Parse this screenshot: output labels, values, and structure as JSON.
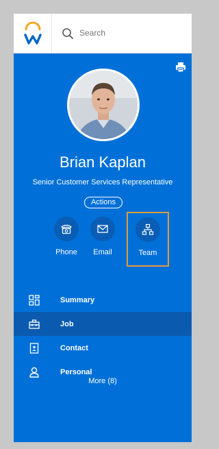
{
  "search": {
    "placeholder": "Search"
  },
  "profile": {
    "name": "Brian Kaplan",
    "job_title": "Senior Customer Services Representative",
    "actions_label": "Actions"
  },
  "quick_actions": [
    {
      "label": "Phone",
      "icon": "phone-icon"
    },
    {
      "label": "Email",
      "icon": "email-icon"
    },
    {
      "label": "Team",
      "icon": "team-icon"
    }
  ],
  "nav": {
    "items": [
      {
        "label": "Summary",
        "icon": "summary-grid-icon"
      },
      {
        "label": "Job",
        "icon": "job-briefcase-icon"
      },
      {
        "label": "Contact",
        "icon": "contact-book-icon"
      },
      {
        "label": "Personal",
        "icon": "person-icon"
      }
    ],
    "active": "Job",
    "more_label": "More (8)"
  },
  "colors": {
    "panel": "#0070d8",
    "active_row": "#0a5bb0",
    "highlight_outline": "#e19a3d",
    "logo_orange": "#f5a623",
    "logo_blue": "#0a67c8"
  }
}
